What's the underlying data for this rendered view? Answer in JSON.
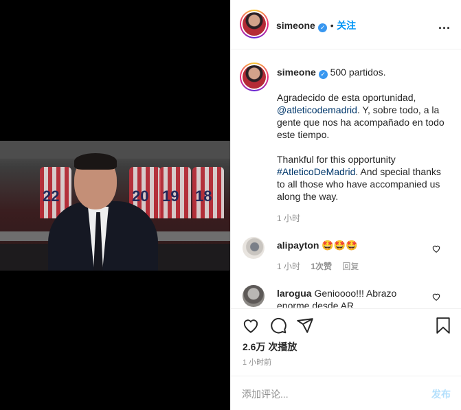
{
  "post": {
    "username": "simeone",
    "dot": "•",
    "follow_label": "关注",
    "more_label": "..."
  },
  "caption": {
    "username": "simeone",
    "title": "500 partidos.",
    "es_line1": "Agradecido de esta oportunidad,",
    "es_mention": "@atleticodemadrid",
    "es_line2": ". Y, sobre todo, a la gente que nos ha acompañado en todo este tiempo.",
    "en_line1": "Thankful for this opportunity",
    "en_hashtag": "#AtleticoDeMadrid",
    "en_line2": ". And special thanks to all those who have accompanied us along the way.",
    "time": "1 小时"
  },
  "comments": [
    {
      "username": "alipayton",
      "text": "🤩🤩🤩",
      "time": "1 小时",
      "likes": "1次赞",
      "reply": "回复"
    },
    {
      "username": "larogua",
      "text": "Genioooo!!! Abrazo enorme desde AR"
    }
  ],
  "stats": {
    "views": "2.6万 次播放",
    "posted": "1 小时前"
  },
  "add_comment": {
    "placeholder": "添加评论...",
    "post_label": "发布"
  },
  "video": {
    "jersey_numbers": [
      "22",
      "20",
      "19",
      "18"
    ]
  },
  "colors": {
    "accent": "#0095f6",
    "verified": "#3897f0",
    "muted": "#8e8e8e",
    "post_disabled": "#b2dffc"
  },
  "icons": [
    "heart-icon",
    "comment-icon",
    "share-icon",
    "bookmark-icon",
    "more-icon",
    "verified-icon"
  ]
}
